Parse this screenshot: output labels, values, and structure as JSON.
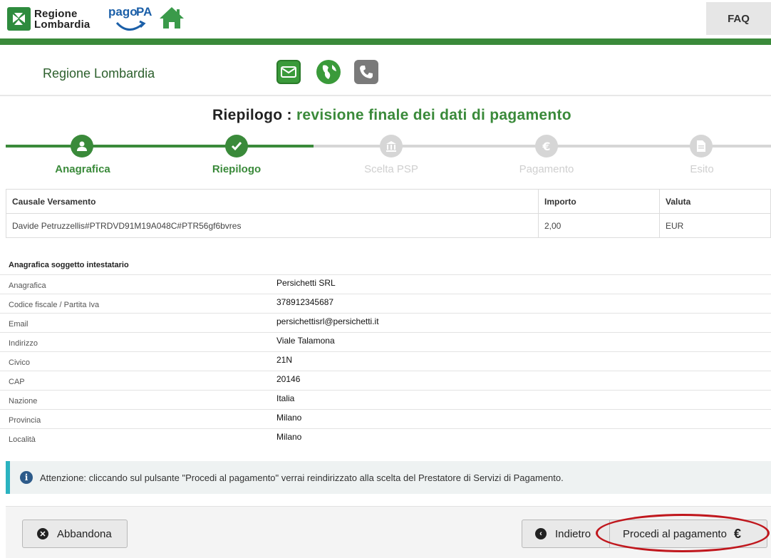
{
  "header": {
    "brand_line1": "Regione",
    "brand_line2": "Lombardia",
    "faq_label": "FAQ"
  },
  "subheader": {
    "title": "Regione Lombardia"
  },
  "page": {
    "title_main": "Riepilogo : ",
    "title_accent": "revisione finale dei dati di pagamento"
  },
  "stepper": {
    "steps": [
      {
        "label": "Anagrafica",
        "state": "done"
      },
      {
        "label": "Riepilogo",
        "state": "active"
      },
      {
        "label": "Scelta PSP",
        "state": "pending"
      },
      {
        "label": "Pagamento",
        "state": "pending"
      },
      {
        "label": "Esito",
        "state": "pending"
      }
    ]
  },
  "payment": {
    "headers": [
      "Causale Versamento",
      "Importo",
      "Valuta"
    ],
    "row": [
      "Davide Petruzzellis#PTRDVD91M19A048C#PTR56gf6bvres",
      "2,00",
      "EUR"
    ]
  },
  "anagrafica": {
    "section_title": "Anagrafica soggetto intestatario",
    "rows": [
      {
        "label": "Anagrafica",
        "value": "Persichetti SRL"
      },
      {
        "label": "Codice fiscale / Partita Iva",
        "value": "378912345687"
      },
      {
        "label": "Email",
        "value": "persichettisrl@persichetti.it"
      },
      {
        "label": "Indirizzo",
        "value": "Viale Talamona"
      },
      {
        "label": "Civico",
        "value": "21N"
      },
      {
        "label": "CAP",
        "value": "20146"
      },
      {
        "label": "Nazione",
        "value": "Italia"
      },
      {
        "label": "Provincia",
        "value": "Milano"
      },
      {
        "label": "Località",
        "value": "Milano"
      }
    ]
  },
  "alert": {
    "text": "Attenzione: cliccando sul pulsante \"Procedi al pagamento\" verrai reindirizzato alla scelta del Prestatore di Servizi di Pagamento."
  },
  "footer": {
    "abbandona_label": "Abbandona",
    "indietro_label": "Indietro",
    "procedi_label": "Procedi al pagamento",
    "procedi_symbol": "€"
  },
  "colors": {
    "brand_green": "#3a8a3a",
    "inactive_grey": "#d6d6d6",
    "alert_accent": "#2bb3c0",
    "highlight_red": "#c0171d"
  }
}
